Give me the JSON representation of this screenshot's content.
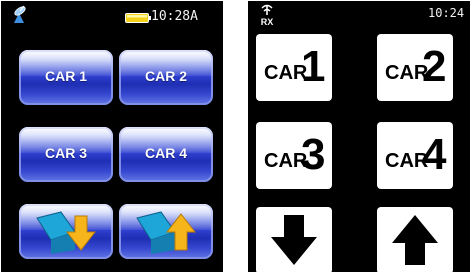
{
  "screen_blue": {
    "status": {
      "time": "10:28A",
      "icons": [
        "satellite-icon",
        "battery-icon"
      ]
    },
    "buttons": [
      {
        "label": "CAR 1"
      },
      {
        "label": "CAR 2"
      },
      {
        "label": "CAR 3"
      },
      {
        "label": "CAR 4"
      },
      {
        "icon": "down-arrow-icon"
      },
      {
        "icon": "up-arrow-icon"
      }
    ]
  },
  "screen_bw": {
    "status": {
      "rx_label": "RX",
      "time": "10:24"
    },
    "buttons": [
      {
        "prefix": "CAR",
        "number": "1"
      },
      {
        "prefix": "CAR",
        "number": "2"
      },
      {
        "prefix": "CAR",
        "number": "3"
      },
      {
        "prefix": "CAR",
        "number": "4"
      },
      {
        "icon": "down-arrow-icon"
      },
      {
        "icon": "up-arrow-icon"
      }
    ]
  },
  "colors": {
    "button_blue": "#2f3fcf",
    "battery_yellow": "#f4d21a",
    "arrow_yellow": "#f7b51c",
    "arrow_teal": "#1fa6d8"
  }
}
